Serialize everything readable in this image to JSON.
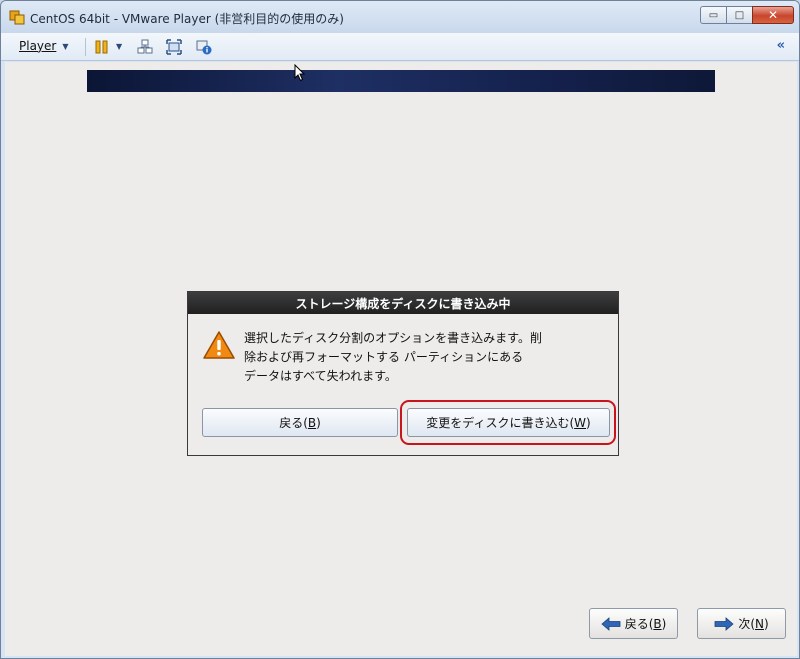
{
  "window": {
    "title": "CentOS 64bit - VMware Player (非営利目的の使用のみ)",
    "minimize_glyph": "▭",
    "maximize_glyph": "□",
    "close_glyph": "✕"
  },
  "toolbar": {
    "player_label": "Player",
    "caret": "▼",
    "collapse_glyph": "«",
    "icons": [
      "pause-icon",
      "send-ctrl-alt-del-icon",
      "fullscreen-icon",
      "vm-settings-icon"
    ]
  },
  "dialog": {
    "title": "ストレージ構成をディスクに書き込み中",
    "message_lines": [
      "選択したディスク分割のオプションを書き込みます。削",
      "除および再フォーマットする パーティションにある",
      "データはすべて失われます。"
    ],
    "back_button": {
      "prefix": "戻る(",
      "key": "B",
      "suffix": ")"
    },
    "write_button": {
      "prefix": "変更をディスクに書き込む(",
      "key": "W",
      "suffix": ")"
    }
  },
  "footer": {
    "back_button": {
      "prefix": "戻る(",
      "key": "B",
      "suffix": ")"
    },
    "next_button": {
      "prefix": "次(",
      "key": "N",
      "suffix": ")"
    }
  },
  "colors": {
    "highlight": "#c8141c",
    "banner": "#15224e",
    "dialog_title_bg": "#202020",
    "warning": "#f08a12"
  }
}
